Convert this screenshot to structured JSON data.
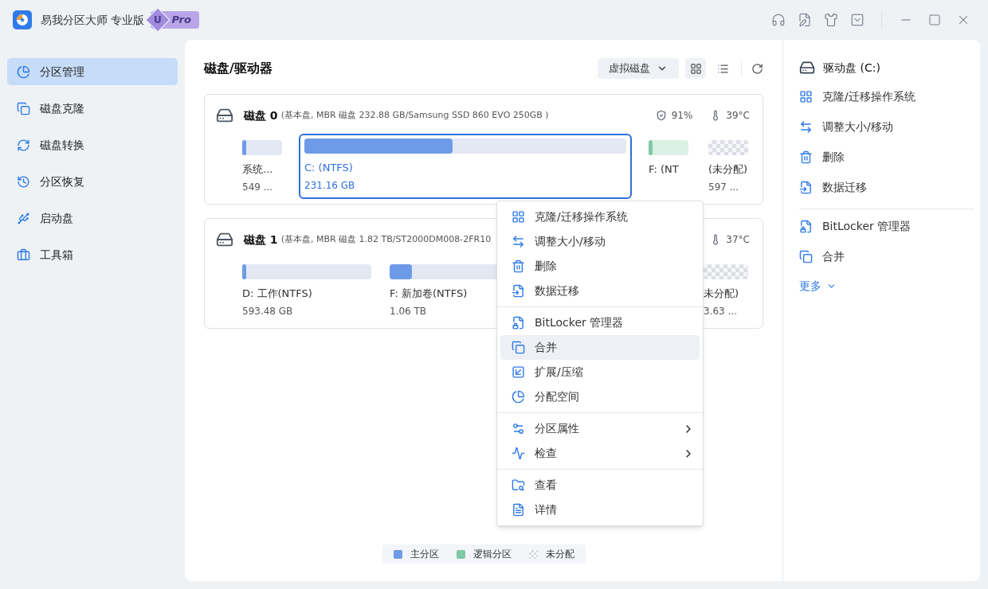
{
  "window": {
    "title": "易我分区大师 专业版",
    "badge": {
      "mark": "U",
      "label": "Pro"
    }
  },
  "sidebar": {
    "items": [
      {
        "label": "分区管理",
        "selected": true
      },
      {
        "label": "磁盘克隆",
        "selected": false
      },
      {
        "label": "磁盘转换",
        "selected": false
      },
      {
        "label": "分区恢复",
        "selected": false
      },
      {
        "label": "启动盘",
        "selected": false
      },
      {
        "label": "工具箱",
        "selected": false
      }
    ]
  },
  "toolbar": {
    "title": "磁盘/驱动器",
    "dropdown": "虚拟磁盘",
    "views": [
      {
        "kind": "grid",
        "selected": true
      },
      {
        "kind": "list",
        "selected": false
      }
    ]
  },
  "disks": [
    {
      "name": "磁盘 0",
      "detail": "(基本盘, MBR 磁盘 232.88 GB/Samsung SSD 860 EVO 250GB )",
      "health": "91%",
      "temperature": "39°C",
      "partitions": [
        {
          "kind": "primary",
          "label": "系统...",
          "size": "549 ...",
          "level": 0.08,
          "selected": false
        },
        {
          "kind": "primary",
          "label": "C: (NTFS)",
          "size": "231.16 GB",
          "level": 0.46,
          "selected": true
        },
        {
          "kind": "logical",
          "label": "F: (NT",
          "level": 0.1,
          "selected": false
        },
        {
          "kind": "unallocated",
          "label": "(未分配)",
          "size": "597 ...",
          "selected": false
        }
      ]
    },
    {
      "name": "磁盘 1",
      "detail": "(基本盘, MBR 磁盘 1.82 TB/ST2000DM008-2FR10",
      "temperature": "37°C",
      "partitions": [
        {
          "kind": "primary",
          "label": "D: 工作(NTFS)",
          "size": "593.48 GB",
          "level": 0.03,
          "selected": false
        },
        {
          "kind": "primary",
          "label": "F: 新加卷(NTFS)",
          "size": "1.06 TB",
          "level": 0.17,
          "selected": false
        },
        {
          "kind": "unallocated",
          "label": "未分配)",
          "size": "3.63 ...",
          "selected": false
        }
      ]
    }
  ],
  "legend": [
    {
      "kind": "swatch",
      "label": "主分区",
      "color": "#6e9be8"
    },
    {
      "kind": "swatch",
      "label": "逻辑分区",
      "color": "#7fc9a8"
    },
    {
      "kind": "unallocated",
      "label": "未分配"
    }
  ],
  "context_menu": {
    "groups": [
      [
        {
          "label": "克隆/迁移操作系统",
          "selected": false,
          "has_submenu": false
        },
        {
          "label": "调整大小/移动",
          "selected": false,
          "has_submenu": false
        },
        {
          "label": "删除",
          "selected": false,
          "has_submenu": false
        },
        {
          "label": "数据迁移",
          "selected": false,
          "has_submenu": false
        }
      ],
      [
        {
          "label": "BitLocker 管理器",
          "selected": false,
          "has_submenu": false
        },
        {
          "label": "合并",
          "selected": true,
          "has_submenu": false
        },
        {
          "label": "扩展/压缩",
          "selected": false,
          "has_submenu": false
        },
        {
          "label": "分配空间",
          "selected": false,
          "has_submenu": false
        }
      ],
      [
        {
          "label": "分区属性",
          "selected": false,
          "has_submenu": true
        },
        {
          "label": "检查",
          "selected": false,
          "has_submenu": true
        }
      ],
      [
        {
          "label": "查看",
          "selected": false,
          "has_submenu": false
        },
        {
          "label": "详情",
          "selected": false,
          "has_submenu": false
        }
      ]
    ]
  },
  "details_panel": {
    "title": "驱动盘 (C:)",
    "groups": [
      [
        "克隆/迁移操作系统",
        "调整大小/移动",
        "删除",
        "数据迁移"
      ],
      [
        "BitLocker 管理器",
        "合并"
      ]
    ],
    "more": "更多"
  }
}
